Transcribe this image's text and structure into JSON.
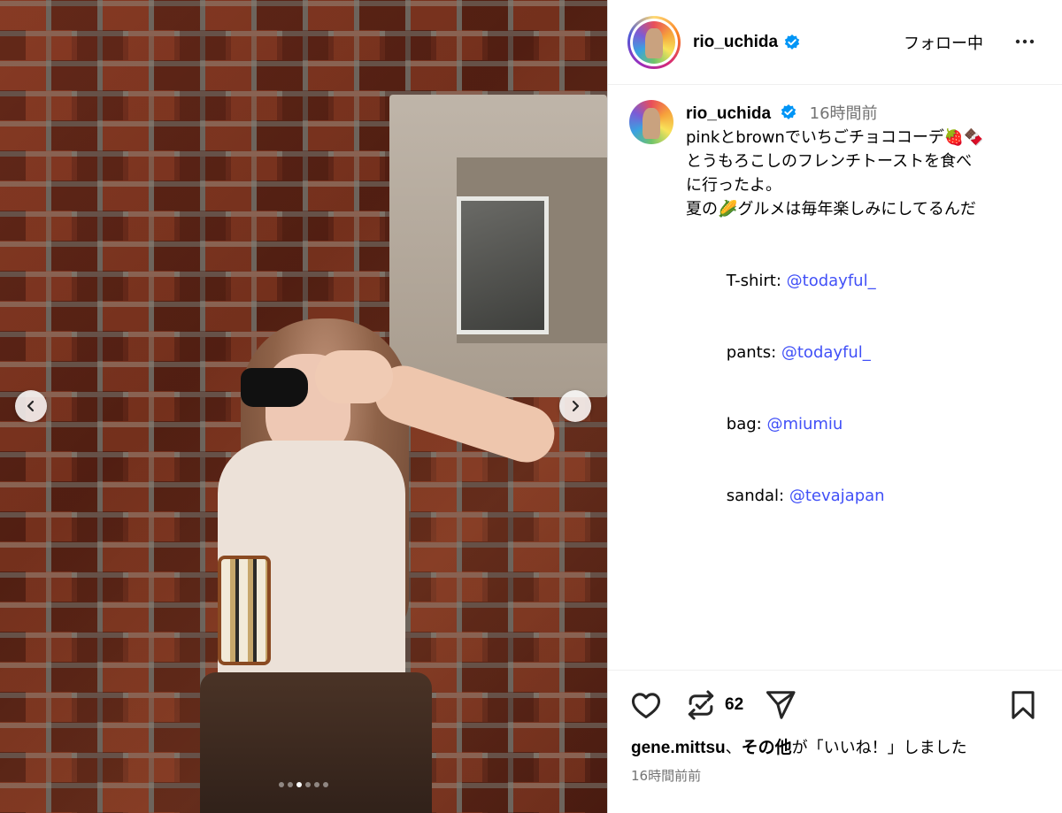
{
  "header": {
    "username": "rio_uchida",
    "follow_label": "フォロー中",
    "more_label": "…"
  },
  "caption": {
    "username": "rio_uchida",
    "time": "16時間前",
    "line1": "pinkとbrownでいちごチョココーデ🍓🍫",
    "line2": "とうもろこしのフレンチトーストを食べ",
    "line3": "に行ったよ。",
    "line4": "夏の🌽グルメは毎年楽しみにしてるんだ",
    "credits": [
      {
        "label": "T-shirt: ",
        "mention": "@todayful_"
      },
      {
        "label": "pants: ",
        "mention": "@todayful_"
      },
      {
        "label": "bag: ",
        "mention": "@miumiu"
      },
      {
        "label": "sandal: ",
        "mention": "@tevajapan"
      }
    ]
  },
  "actions": {
    "repost_count": "62",
    "liked_by_user": "gene.mittsu",
    "liked_by_sep": "、",
    "liked_by_others": "その他",
    "liked_by_suffix": "が「いいね！」しました",
    "post_time": "16時間前前"
  },
  "carousel": {
    "total": 6,
    "active_index": 2
  },
  "colors": {
    "mention": "#4150f7",
    "verified": "#0095f6",
    "muted": "#737373"
  }
}
